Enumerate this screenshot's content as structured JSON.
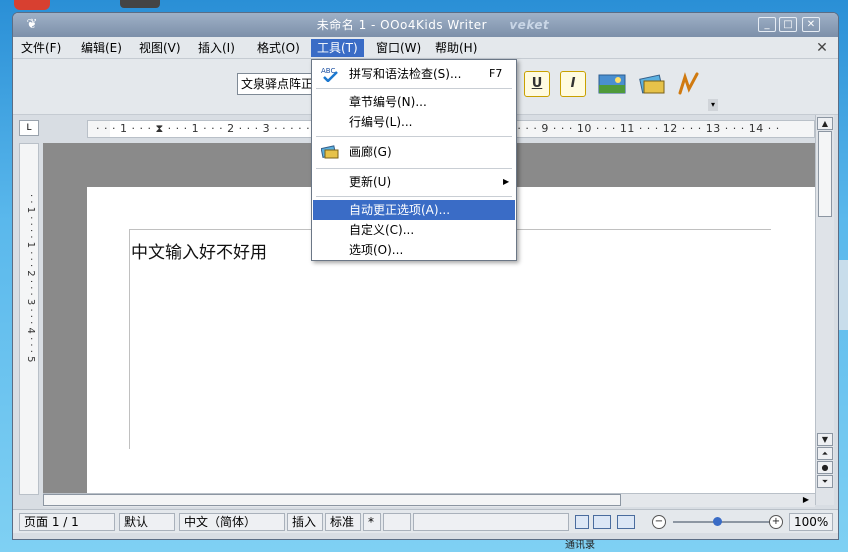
{
  "window": {
    "title": "未命名 1 - OOo4Kids Writer",
    "watermark": "veket",
    "btn_minimize": "_",
    "btn_maximize": "□",
    "btn_close": "✕",
    "doc_close": "✕"
  },
  "menubar": {
    "items": [
      {
        "label": "文件(F)"
      },
      {
        "label": "编辑(E)"
      },
      {
        "label": "视图(V)"
      },
      {
        "label": "插入(I)"
      },
      {
        "label": "格式(O)"
      },
      {
        "label": "工具(T)"
      },
      {
        "label": "窗口(W)"
      },
      {
        "label": "帮助(H)"
      }
    ],
    "active_index": 5
  },
  "toolbar": {
    "font_name": "文泉驿点阵正",
    "underline_label": "U",
    "italic_label": "I"
  },
  "ruler": {
    "horizontal": "· · · 1 · · · ⧗ · · · 1 · · · 2 · · · 3 · · · · · · · · · · · · · · · · · · · · · · · · · · · · · 8 · · · 9 · · · 10 · · · 11 · · · 12 · · · 13 · · · 14 · ·",
    "vertical": "· · 1 · · · · 1 · · · 2 · · · 3 · · · 4 · · · 5"
  },
  "document": {
    "text": "中文输入好不好用"
  },
  "tools_menu": {
    "items": [
      {
        "icon": "spellcheck-icon",
        "label": "拼写和语法检查(S)...",
        "shortcut": "F7"
      },
      {
        "label": "章节编号(N)..."
      },
      {
        "label": "行编号(L)..."
      },
      {
        "icon": "gallery-icon",
        "label": "画廊(G)"
      },
      {
        "label": "更新(U)",
        "submenu": true
      },
      {
        "label": "自动更正选项(A)...",
        "highlighted": true
      },
      {
        "label": "自定义(C)..."
      },
      {
        "label": "选项(O)..."
      }
    ]
  },
  "statusbar": {
    "page": "页面  1 / 1",
    "style": "默认",
    "language": "中文（简体）",
    "insert_mode": "插入",
    "selection_mode": "标准",
    "modified": "*",
    "zoom": "100%"
  },
  "desktop": {
    "icon_label": "通讯录"
  },
  "colors": {
    "accent": "#3a6cc6",
    "titlebar": "#8497b0",
    "desktop": "#4aa8e4"
  }
}
